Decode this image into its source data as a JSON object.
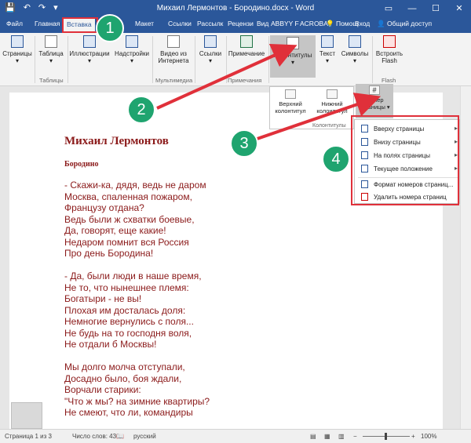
{
  "window": {
    "title": "Михаил Лермонтов - Бородино.docx - Word",
    "qat": [
      "💾",
      "↶",
      "↷",
      "▾"
    ]
  },
  "tabs": {
    "items": [
      "Файл",
      "Главная",
      "Вставка",
      "Макет",
      "Ссылки",
      "Рассылк",
      "Рецензи",
      "Вид",
      "ABBYY F",
      "ACROBA"
    ],
    "help": "Помощ",
    "signin": "Вход",
    "share": "Общий доступ"
  },
  "ribbon": {
    "buttons": [
      "Страницы",
      "Таблица",
      "Иллюстрации",
      "Надстройки",
      "Видео из Интернета",
      "Ссылки",
      "Примечание",
      "Колонтитулы",
      "Текст",
      "Символы",
      "Встроить Flash"
    ],
    "groups": [
      "Таблицы",
      "Мультимедиа",
      "Примечания",
      "Flash"
    ]
  },
  "headerfooter_dropdown": {
    "items": [
      "Верхний колонтитул",
      "Нижний колонтитул",
      "Номер страницы"
    ],
    "group": "Колонтитулы"
  },
  "page_number_menu": {
    "items": [
      "Вверху страницы",
      "Внизу страницы",
      "На полях страницы",
      "Текущее положение"
    ],
    "actions": [
      "Формат номеров страниц...",
      "Удалить номера страниц"
    ]
  },
  "document": {
    "title": "Михаил Лермонтов",
    "subtitle": "Бородино",
    "lines": [
      "- Скажи-ка, дядя, ведь не даром",
      "Москва, спаленная пожаром,",
      "Французу отдана?",
      "Ведь были ж схватки боевые,",
      "Да, говорят, еще какие!",
      "Недаром помнит вся Россия",
      "Про день Бородина!",
      "",
      "- Да, были люди в наше время,",
      "Не то, что нынешнее племя:",
      "Богатыри - не вы!",
      "Плохая им досталась доля:",
      "Немногие вернулись с поля...",
      "Не будь на то господня воля,",
      "Не отдали б Москвы!",
      "",
      "Мы долго молча отступали,",
      "Досадно было, боя ждали,",
      "Ворчали старики:",
      "\"Что ж мы? на зимние квартиры?",
      "Не смеют, что ли, командиры"
    ]
  },
  "callouts": [
    "1",
    "2",
    "3",
    "4"
  ],
  "status": {
    "page": "Страница 1 из 3",
    "words": "Число слов: 430",
    "lang": "русский",
    "zoom": "100%"
  },
  "colors": {
    "word_blue": "#2b579a",
    "doc_text": "#8b1a1a",
    "callout_green": "#1fa46f",
    "highlight_red": "#e0303a"
  }
}
